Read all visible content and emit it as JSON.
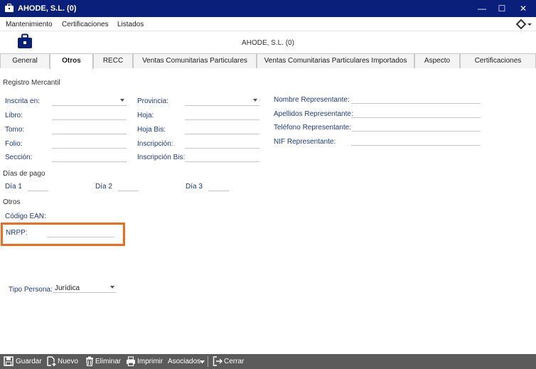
{
  "window": {
    "title": "AHODE, S.L. (0)",
    "minimize": "—",
    "maximize": "☐",
    "close": "✕"
  },
  "menu": {
    "items": [
      "Mantenimiento",
      "Certificaciones",
      "Listados"
    ]
  },
  "header": {
    "title": "AHODE, S.L. (0)"
  },
  "tabs": [
    "General",
    "Otros",
    "RECC",
    "Ventas Comunitarias Particulares",
    "Ventas Comunitarias Particulares Importados",
    "Aspecto",
    "Certificaciones"
  ],
  "active_tab": "Otros",
  "registro": {
    "section": "Registro Mercantil",
    "inscrita_label": "Inscrita en:",
    "libro_label": "Libro:",
    "tomo_label": "Tomo:",
    "folio_label": "Folio:",
    "seccion_label": "Sección:",
    "provincia_label": "Provincia:",
    "hoja_label": "Hoja:",
    "hoja_bis_label": "Hoja Bis:",
    "inscripcion_label": "Inscripción:",
    "inscripcion_bis_label": "Inscripción Bis:",
    "nombre_rep_label": "Nombre Representante:",
    "apellidos_rep_label": "Apellidos Representante:",
    "telefono_rep_label": "Teléfono Representante:",
    "nif_rep_label": "NIF  Representante:"
  },
  "dias_pago": {
    "section": "Días de pago",
    "dia1": "Día 1",
    "dia2": "Día 2",
    "dia3": "Día 3"
  },
  "otros": {
    "section": "Otros",
    "ean_label": "Código EAN:",
    "nrpp_label": "NRPP:"
  },
  "tipo_persona": {
    "label": "Tipo Persona:",
    "value": "Jurídica"
  },
  "toolbar": {
    "guardar": "Guardar",
    "nuevo": "Nuevo",
    "eliminar": "Eliminar",
    "imprimir": "Imprimir",
    "asociados": "Asociados",
    "cerrar": "Cerrar"
  },
  "colors": {
    "titlebar": "#0a1f7a",
    "label": "#1e3a8a",
    "highlight": "#f26b1d",
    "toolbar": "#5b5b5b"
  }
}
